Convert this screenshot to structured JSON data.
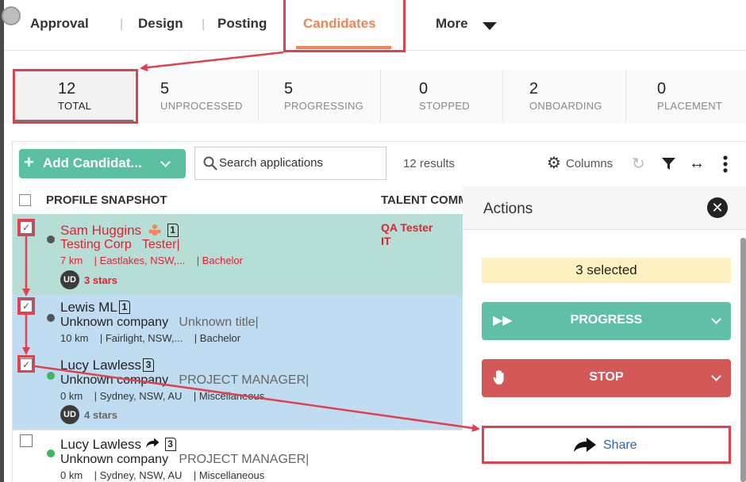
{
  "nav": {
    "tabs": [
      {
        "label": "Approval"
      },
      {
        "label": "Design"
      },
      {
        "label": "Posting"
      },
      {
        "label": "Candidates",
        "active": true
      },
      {
        "label": "More"
      }
    ]
  },
  "stats": [
    {
      "value": "12",
      "label": "TOTAL"
    },
    {
      "value": "5",
      "label": "UNPROCESSED"
    },
    {
      "value": "5",
      "label": "PROGRESSING"
    },
    {
      "value": "0",
      "label": "STOPPED"
    },
    {
      "value": "2",
      "label": "ONBOARDING"
    },
    {
      "value": "0",
      "label": "PLACEMENT"
    }
  ],
  "toolbar": {
    "add_label": "Add Candidat...",
    "search_placeholder": "Search applications",
    "results": "12 results",
    "columns_label": "Columns"
  },
  "table": {
    "headers": [
      "PROFILE SNAPSHOT",
      "TALENT COMM"
    ]
  },
  "candidates": [
    {
      "name": "Sam Huggins",
      "badge": "1",
      "company": "Testing Corp",
      "title": "Tester",
      "details": "7 km    | Eastlakes, NSW,...    | Bachelor",
      "initials": "UD",
      "rating": "3 stars",
      "talent": [
        "QA Tester",
        "IT"
      ],
      "status_color": "#555555",
      "checked": true
    },
    {
      "name": "Lewis ML",
      "badge": "1",
      "company": "Unknown company",
      "title": "Unknown title",
      "details": "10 km    | Fairlight, NSW,...    | Bachelor",
      "status_color": "#555555",
      "checked": true
    },
    {
      "name": "Lucy Lawless",
      "badge": "3",
      "company": "Unknown company",
      "title": "PROJECT MANAGER",
      "details": "0 km    | Sydney, NSW, AU    | Miscellaneous",
      "initials": "UD",
      "rating": "4 stars",
      "status_color": "#3fb55f",
      "checked": true
    },
    {
      "name": "Lucy Lawless",
      "badge": "3",
      "company": "Unknown company",
      "title": "PROJECT MANAGER",
      "details": "0 km    | Sydney, NSW, AU    | Miscellaneous",
      "status_color": "#3fb55f",
      "checked": false
    }
  ],
  "actions": {
    "title": "Actions",
    "selected": "3 selected",
    "progress_label": "PROGRESS",
    "stop_label": "STOP",
    "share_label": "Share"
  },
  "colors": {
    "accent": "#f08458",
    "annotation": "#e0414f",
    "add_button": "#5bbfa2",
    "progress": "#5fc0a7",
    "stop": "#d45858",
    "row_selected_1": "#b7ddd7",
    "row_selected_2": "#c0dcf1"
  }
}
